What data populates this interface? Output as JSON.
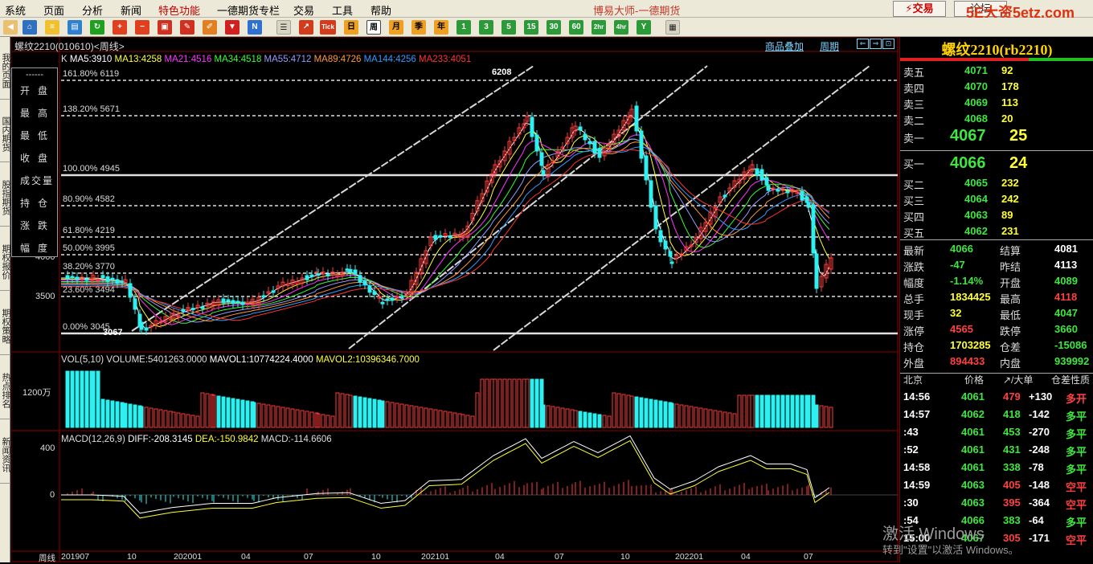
{
  "menu": {
    "items": [
      "系统",
      "页面",
      "分析",
      "新闻",
      "特色功能",
      "一德期货专栏",
      "交易",
      "工具",
      "帮助"
    ],
    "app_title": "博易大师-一德期货",
    "trade_button": "交易",
    "trade_button2": "论坛",
    "watermark": "5E大资5etz.com"
  },
  "toolbar": {
    "period_buttons": [
      "周",
      "月",
      "季",
      "年",
      "1",
      "3",
      "5",
      "15",
      "30",
      "60",
      "2hr",
      "4hr",
      "Y"
    ]
  },
  "left_tabs": [
    "我的页面",
    "国内期货",
    "股指期货",
    "期权报价",
    "期权策略",
    "热点排名",
    "新闻资讯"
  ],
  "chart": {
    "symbol_label": "螺纹2210(010610)<周线>",
    "ma_labels": [
      {
        "text": "K",
        "color": "#dddddd"
      },
      {
        "text": "MA5:3910",
        "color": "#ffffff"
      },
      {
        "text": "MA13:4258",
        "color": "#ffff33"
      },
      {
        "text": "MA21:4516",
        "color": "#ff33ff"
      },
      {
        "text": "MA34:4518",
        "color": "#33ff33"
      },
      {
        "text": "MA55:4712",
        "color": "#9999ff"
      },
      {
        "text": "MA89:4726",
        "color": "#ff9933"
      },
      {
        "text": "MA144:4256",
        "color": "#3399ff"
      },
      {
        "text": "MA233:4051",
        "color": "#ff3333"
      }
    ],
    "top_right_links": [
      "商品叠加",
      "周期"
    ],
    "fib_levels": [
      {
        "label": "161.80% 6119"
      },
      {
        "label": "138.20% 5671"
      },
      {
        "label": "100.00% 4945"
      },
      {
        "label": "80.90% 4582"
      },
      {
        "label": "61.80% 4219"
      },
      {
        "label": "50.00% 3995"
      },
      {
        "label": "38.20% 3770"
      },
      {
        "label": "23.60% 3494"
      },
      {
        "label": "0.00% 3045"
      }
    ],
    "price_axis_label": "3500",
    "price_axis_label2": "4000",
    "high_mark": "6208",
    "low_mark": "3067",
    "vol_label": "VOL(5,10)",
    "vol_text": "VOLUME:5401263.0000",
    "mavol1": "MAVOL1:10774224.4000",
    "mavol2": "MAVOL2:10396346.7000",
    "vol_axis": "1200万",
    "macd_label": "MACD(12,26,9)",
    "diff": "DIFF:-208.3145",
    "dea": "DEA:-150.9842",
    "macd_val": "MACD:-114.6606",
    "macd_axis": [
      "400",
      "0"
    ],
    "date_axis": [
      "周线",
      "201907",
      "10",
      "202001",
      "04",
      "07",
      "10",
      "202101",
      "04",
      "07",
      "10",
      "202201",
      "04",
      "07"
    ]
  },
  "infobox": {
    "header": "------",
    "rows": [
      "开盘",
      "最高",
      "最低",
      "收盘",
      "成交量",
      "持仓",
      "涨跌",
      "幅度"
    ]
  },
  "quote": {
    "title": "螺纹2210(rb2210)",
    "asks": [
      {
        "label": "卖五",
        "price": "4071",
        "vol": "92"
      },
      {
        "label": "卖四",
        "price": "4070",
        "vol": "178"
      },
      {
        "label": "卖三",
        "price": "4069",
        "vol": "113"
      },
      {
        "label": "卖二",
        "price": "4068",
        "vol": "20"
      },
      {
        "label": "卖一",
        "price": "4067",
        "vol": "25"
      }
    ],
    "bids": [
      {
        "label": "买一",
        "price": "4066",
        "vol": "24"
      },
      {
        "label": "买二",
        "price": "4065",
        "vol": "232"
      },
      {
        "label": "买三",
        "price": "4064",
        "vol": "242"
      },
      {
        "label": "买四",
        "price": "4063",
        "vol": "89"
      },
      {
        "label": "买五",
        "price": "4062",
        "vol": "231"
      }
    ],
    "stats": [
      {
        "l1": "最新",
        "v1": "4066",
        "c1": "g",
        "l2": "结算",
        "v2": "4081",
        "c2": "w"
      },
      {
        "l1": "涨跌",
        "v1": "-47",
        "c1": "g",
        "l2": "昨结",
        "v2": "4113",
        "c2": "w"
      },
      {
        "l1": "幅度",
        "v1": "-1.14%",
        "c1": "g",
        "l2": "开盘",
        "v2": "4089",
        "c2": "g"
      },
      {
        "l1": "总手",
        "v1": "1834425",
        "c1": "y",
        "l2": "最高",
        "v2": "4118",
        "c2": "r"
      },
      {
        "l1": "现手",
        "v1": "32",
        "c1": "y",
        "l2": "最低",
        "v2": "4047",
        "c2": "g"
      },
      {
        "l1": "涨停",
        "v1": "4565",
        "c1": "r",
        "l2": "跌停",
        "v2": "3660",
        "c2": "g"
      },
      {
        "l1": "持仓",
        "v1": "1703285",
        "c1": "y",
        "l2": "仓差",
        "v2": "-15086",
        "c2": "g"
      },
      {
        "l1": "外盘",
        "v1": "894433",
        "c1": "r",
        "l2": "内盘",
        "v2": "939992",
        "c2": "g"
      }
    ],
    "ticks_header": [
      "北京",
      "价格",
      "↗/大单",
      "仓差",
      "性质"
    ],
    "ticks": [
      {
        "t": "14:56",
        "p": "4061",
        "v": "479",
        "vc": "r",
        "d": "+130",
        "dc": "w",
        "n": "多开",
        "nc": "r"
      },
      {
        "t": "14:57",
        "p": "4062",
        "v": "418",
        "vc": "g",
        "d": "-142",
        "dc": "w",
        "n": "多平",
        "nc": "g"
      },
      {
        "t": ":43",
        "p": "4061",
        "v": "453",
        "vc": "g",
        "d": "-270",
        "dc": "w",
        "n": "多平",
        "nc": "g"
      },
      {
        "t": ":52",
        "p": "4061",
        "v": "431",
        "vc": "g",
        "d": "-248",
        "dc": "w",
        "n": "多平",
        "nc": "g"
      },
      {
        "t": "14:58",
        "p": "4061",
        "v": "338",
        "vc": "g",
        "d": "-78",
        "dc": "w",
        "n": "多平",
        "nc": "g"
      },
      {
        "t": "14:59",
        "p": "4063",
        "v": "405",
        "vc": "r",
        "d": "-148",
        "dc": "w",
        "n": "空平",
        "nc": "r"
      },
      {
        "t": ":30",
        "p": "4063",
        "v": "395",
        "vc": "r",
        "d": "-364",
        "dc": "w",
        "n": "空平",
        "nc": "r"
      },
      {
        "t": ":54",
        "p": "4066",
        "v": "383",
        "vc": "g",
        "d": "-64",
        "dc": "w",
        "n": "多平",
        "nc": "g"
      },
      {
        "t": "15:00",
        "p": "4067",
        "v": "305",
        "vc": "r",
        "d": "-171",
        "dc": "w",
        "n": "空平",
        "nc": "r"
      }
    ]
  },
  "activate": {
    "line1": "激活 Windows",
    "line2": "转到\"设置\"以激活 Windows。"
  }
}
